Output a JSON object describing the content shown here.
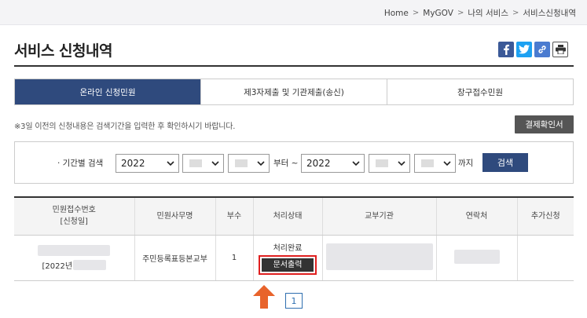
{
  "breadcrumb": {
    "items": [
      "Home",
      "MyGOV",
      "나의 서비스",
      "서비스신청내역"
    ],
    "separator": ">"
  },
  "page": {
    "title": "서비스 신청내역"
  },
  "share": {
    "icons": [
      "facebook-icon",
      "twitter-icon",
      "link-icon",
      "print-icon"
    ]
  },
  "tabs": [
    {
      "label": "온라인 신청민원",
      "active": true
    },
    {
      "label": "제3자제출 및 기관제출(송신)",
      "active": false
    },
    {
      "label": "창구접수민원",
      "active": false
    }
  ],
  "notice": "※3일 이전의 신청내용은 검색기간을 입력한 후 확인하시기 바랍니다.",
  "receipt_button": "결제확인서",
  "search": {
    "label": "· 기간별 검색",
    "from_year": "2022",
    "to_year": "2022",
    "from_suffix": "부터 ~",
    "to_suffix": "까지",
    "button": "검색"
  },
  "table": {
    "headers": {
      "receipt_no_line1": "민원접수번호",
      "receipt_no_line2": "[신청일]",
      "service": "민원사무명",
      "copies": "부수",
      "status": "처리상태",
      "agency": "교부기관",
      "contact": "연락처",
      "extra": "추가신청"
    },
    "rows": [
      {
        "date_prefix": "[2022년",
        "service": "주민등록표등본교부",
        "copies": "1",
        "status": "처리완료",
        "print_button": "문서출력"
      }
    ]
  },
  "pagination": {
    "current": "1"
  },
  "colors": {
    "primary": "#2f4a7d",
    "highlight": "#e01f1f",
    "arrow": "#e8632b"
  }
}
